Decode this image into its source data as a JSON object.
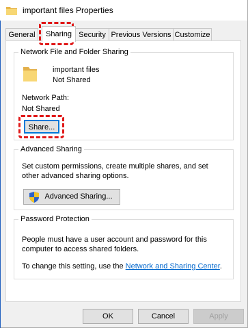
{
  "window": {
    "title": "important files Properties"
  },
  "tabs": [
    {
      "label": "General"
    },
    {
      "label": "Sharing"
    },
    {
      "label": "Security"
    },
    {
      "label": "Previous Versions"
    },
    {
      "label": "Customize"
    }
  ],
  "network_sharing": {
    "legend": "Network File and Folder Sharing",
    "folder_name": "important files",
    "folder_status": "Not Shared",
    "path_label": "Network Path:",
    "path_value": "Not Shared",
    "share_button": "Share..."
  },
  "advanced_sharing": {
    "legend": "Advanced Sharing",
    "description": "Set custom permissions, create multiple shares, and set other advanced sharing options.",
    "button": "Advanced Sharing..."
  },
  "password_protection": {
    "legend": "Password Protection",
    "description": "People must have a user account and password for this computer to access shared folders.",
    "change_prefix": "To change this setting, use the",
    "link": "Network and Sharing Center",
    "change_suffix": "."
  },
  "footer": {
    "ok": "OK",
    "cancel": "Cancel",
    "apply": "Apply"
  },
  "colors": {
    "highlight": "#e01818",
    "link": "#0066cc",
    "focus": "#0078d7"
  }
}
